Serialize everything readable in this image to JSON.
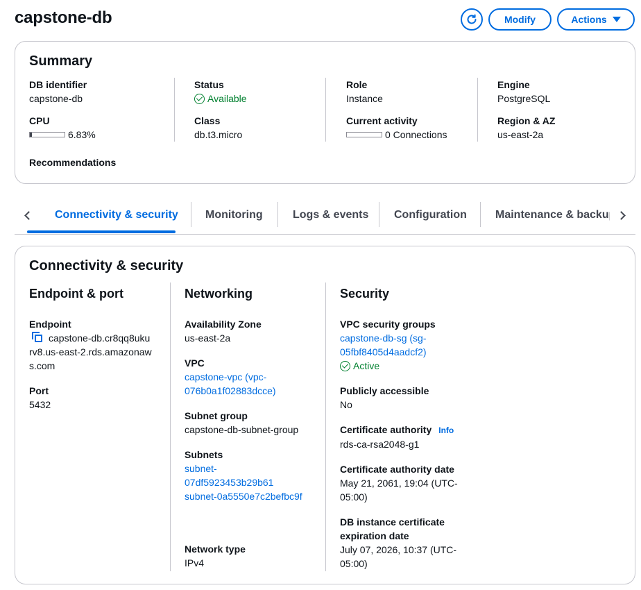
{
  "header": {
    "title": "capstone-db",
    "refresh_icon": "refresh-icon",
    "modify_label": "Modify",
    "actions_label": "Actions"
  },
  "summary": {
    "title": "Summary",
    "db_identifier_label": "DB identifier",
    "db_identifier": "capstone-db",
    "cpu_label": "CPU",
    "cpu_value": "6.83%",
    "cpu_fraction": 0.0683,
    "status_label": "Status",
    "status": "Available",
    "class_label": "Class",
    "class": "db.t3.micro",
    "role_label": "Role",
    "role": "Instance",
    "current_activity_label": "Current activity",
    "current_activity": "0 Connections",
    "current_activity_fraction": 0,
    "engine_label": "Engine",
    "engine": "PostgreSQL",
    "region_label": "Region & AZ",
    "region": "us-east-2a",
    "recommendations_label": "Recommendations"
  },
  "tabs": {
    "items": [
      {
        "label": "Connectivity & security"
      },
      {
        "label": "Monitoring"
      },
      {
        "label": "Logs & events"
      },
      {
        "label": "Configuration"
      },
      {
        "label": "Maintenance & backups"
      }
    ],
    "active_index": 0
  },
  "connectivity": {
    "title": "Connectivity & security",
    "endpoint_section": {
      "title": "Endpoint & port",
      "endpoint_label": "Endpoint",
      "endpoint_line1": "capstone-db.cr8qq8uku",
      "endpoint_line2": "rv8.us-east-2.rds.amazonaw",
      "endpoint_line3": "s.com",
      "port_label": "Port",
      "port": "5432"
    },
    "networking_section": {
      "title": "Networking",
      "az_label": "Availability Zone",
      "az": "us-east-2a",
      "vpc_label": "VPC",
      "vpc_line1": "capstone-vpc (vpc-",
      "vpc_line2": "076b0a1f02883dcce)",
      "subnet_group_label": "Subnet group",
      "subnet_group": "capstone-db-subnet-group",
      "subnets_label": "Subnets",
      "subnet1_line1": "subnet-",
      "subnet1_line2": "07df5923453b29b61",
      "subnet2": "subnet-0a5550e7c2befbc9f",
      "network_type_label": "Network type",
      "network_type": "IPv4"
    },
    "security_section": {
      "title": "Security",
      "sg_label": "VPC security groups",
      "sg_line1": "capstone-db-sg (sg-",
      "sg_line2": "05fbf8405d4aadcf2)",
      "sg_status": "Active",
      "public_label": "Publicly accessible",
      "public": "No",
      "ca_label": "Certificate authority",
      "ca_info": "Info",
      "ca": "rds-ca-rsa2048-g1",
      "ca_date_label": "Certificate authority date",
      "ca_date_line1": "May 21, 2061, 19:04 (UTC-",
      "ca_date_line2": "05:00)",
      "cert_exp_label_line1": "DB instance certificate",
      "cert_exp_label_line2": "expiration date",
      "cert_exp_line1": "July 07, 2026, 10:37 (UTC-",
      "cert_exp_line2": "05:00)"
    }
  },
  "colors": {
    "accent": "#006ce0",
    "success": "#00802f",
    "border": "#c6c6cd",
    "text": "#0f141a"
  }
}
